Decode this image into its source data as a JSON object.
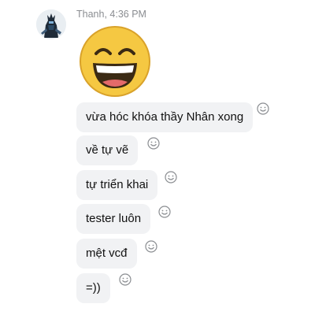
{
  "sender": {
    "name_time": "Thanh, 4:36 PM"
  },
  "sticker": {
    "icon": "laughing-grin-emoji"
  },
  "reaction_icon": "smiley-face-icon",
  "messages": [
    {
      "text": "vừa hóc khóa thầy Nhân xong"
    },
    {
      "text": "về tự vẽ"
    },
    {
      "text": "tự triển khai"
    },
    {
      "text": "tester luôn"
    },
    {
      "text": "mệt vcđ"
    },
    {
      "text": "=))"
    }
  ],
  "colors": {
    "bubble": "#f1f2f4",
    "timestamp": "#8a8d91",
    "emoji_face": "#f5c842",
    "emoji_outline": "#d9a22a"
  }
}
